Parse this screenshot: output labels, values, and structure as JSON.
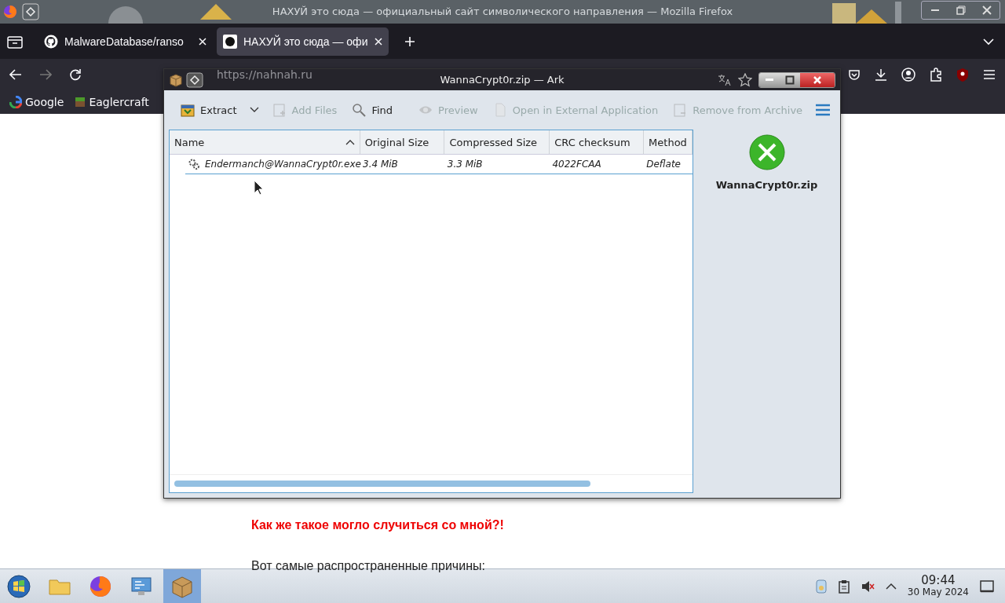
{
  "firefox": {
    "title": "НАХУЙ это сюда — официальный сайт символического направления — Mozilla Firefox",
    "tabs": [
      {
        "label": "MalwareDatabase/ranso",
        "selected": false
      },
      {
        "label": "НАХУЙ это сюда — офи",
        "selected": true
      }
    ],
    "url": "https://nahnah.ru",
    "bookmarks": [
      "Google",
      "Eaglercraft"
    ],
    "page": {
      "heading": "Как же такое могло случиться со мной?!",
      "paragraph": "Вот самые распространенные причины:"
    }
  },
  "ark": {
    "title": "WannaCrypt0r.zip — Ark",
    "toolbar": [
      {
        "kind": "extract",
        "label": "Extract",
        "disabled": false
      },
      {
        "kind": "add",
        "label": "Add Files",
        "disabled": true
      },
      {
        "kind": "find",
        "label": "Find",
        "disabled": false
      },
      {
        "kind": "preview",
        "label": "Preview",
        "disabled": true
      },
      {
        "kind": "open",
        "label": "Open in External Application",
        "disabled": true
      },
      {
        "kind": "remove",
        "label": "Remove from Archive",
        "disabled": true
      }
    ],
    "columns": [
      {
        "label": "Name",
        "sorted": true
      },
      {
        "label": "Original Size",
        "sorted": false
      },
      {
        "label": "Compressed Size",
        "sorted": false
      },
      {
        "label": "CRC checksum",
        "sorted": false
      },
      {
        "label": "Method",
        "sorted": false
      }
    ],
    "rows": [
      {
        "cells": [
          "Endermanch@WannaCrypt0r.exe",
          "3.4 MiB",
          "3.3 MiB",
          "4022FCAA",
          "Deflate"
        ]
      }
    ],
    "archive_name": "WannaCrypt0r.zip"
  },
  "taskbar": {
    "apps": [
      {
        "kind": "start",
        "selected": false
      },
      {
        "kind": "files",
        "selected": false
      },
      {
        "kind": "browser",
        "selected": false
      },
      {
        "kind": "monitor",
        "selected": false
      },
      {
        "kind": "archiver",
        "selected": true
      }
    ],
    "clock": {
      "time": "09:44",
      "date": "30 May 2024"
    }
  }
}
